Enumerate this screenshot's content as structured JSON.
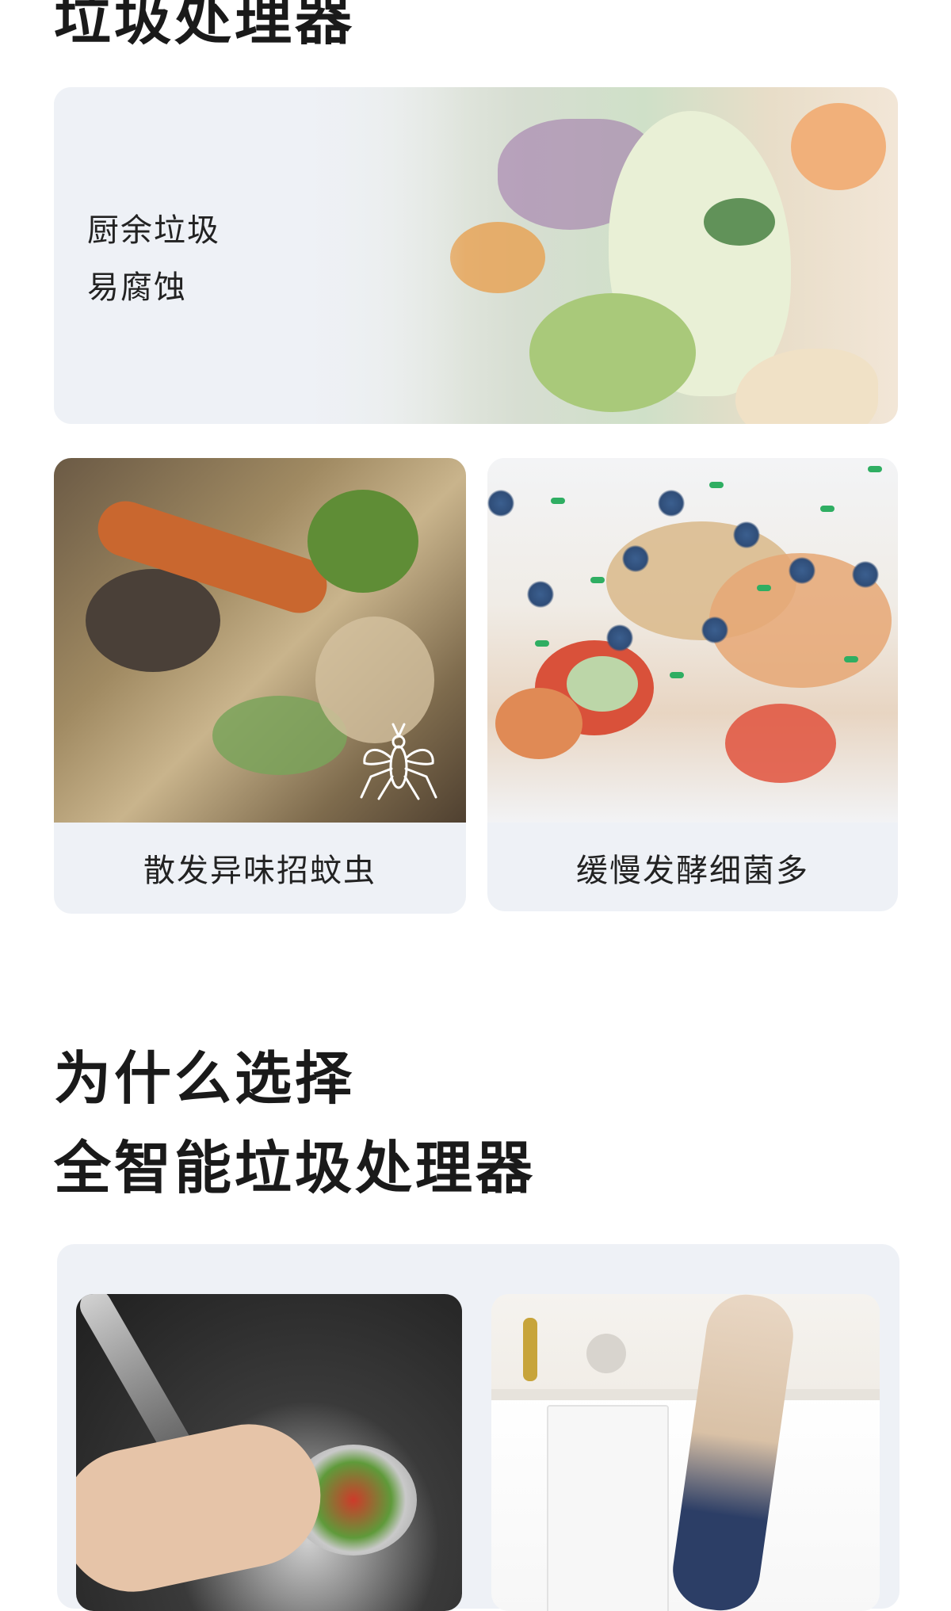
{
  "section1": {
    "heading": "垃圾处理器",
    "hero": {
      "line1": "厨余垃圾",
      "line2": "易腐蚀"
    },
    "cards": [
      {
        "caption": "散发异味招蚊虫"
      },
      {
        "caption": "缓慢发酵细菌多"
      }
    ]
  },
  "section2": {
    "heading_line1": "为什么选择",
    "heading_line2": "全智能垃圾处理器"
  },
  "colors": {
    "card_bg": "#eef1f6",
    "text": "#1a1a1a",
    "germ": "#2f4d78",
    "germ_pill": "#2fae62"
  }
}
